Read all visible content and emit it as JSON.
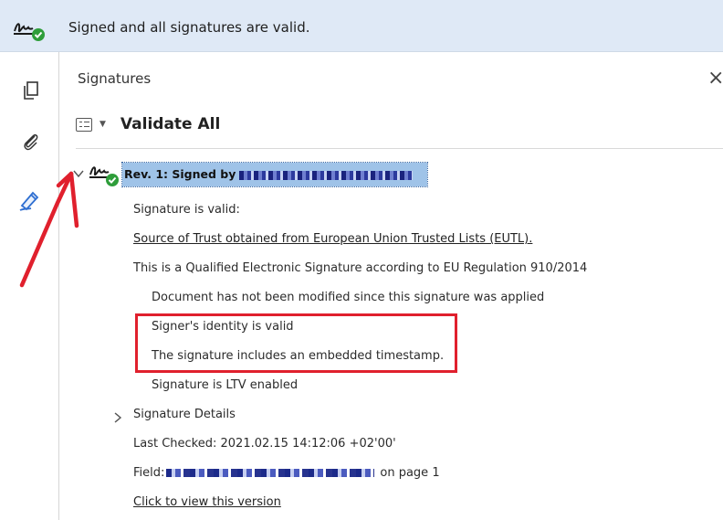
{
  "banner": {
    "status_text": "Signed and all signatures are valid.",
    "icon": "signature-valid-icon"
  },
  "toolbar": {
    "items": [
      {
        "name": "pages-icon"
      },
      {
        "name": "attachments-icon"
      },
      {
        "name": "signatures-pen-icon"
      }
    ]
  },
  "panel": {
    "title": "Signatures",
    "close_glyph": "×",
    "validate_all_label": "Validate All"
  },
  "signature": {
    "revision_label": "Rev. 1: Signed by",
    "lines": {
      "valid": "Signature is valid:",
      "trust_source": "Source of Trust obtained from European Union Trusted Lists (EUTL).",
      "qualified": "This is a Qualified Electronic Signature according to EU Regulation 910/2014",
      "not_modified": "Document has not been modified since this signature was applied",
      "identity": "Signer's identity is valid",
      "timestamp": "The signature includes an embedded timestamp.",
      "ltv": "Signature is LTV enabled",
      "details": "Signature Details",
      "last_checked": "Last Checked: 2021.02.15 14:12:06 +02'00'",
      "field_prefix": "Field:",
      "field_suffix": "on page 1",
      "view_version": "Click to view this version"
    }
  },
  "colors": {
    "banner_bg": "#dfe9f6",
    "selected_bg": "#9fc3e8",
    "annotation_red": "#e0202d",
    "valid_green": "#2e9d3a"
  }
}
